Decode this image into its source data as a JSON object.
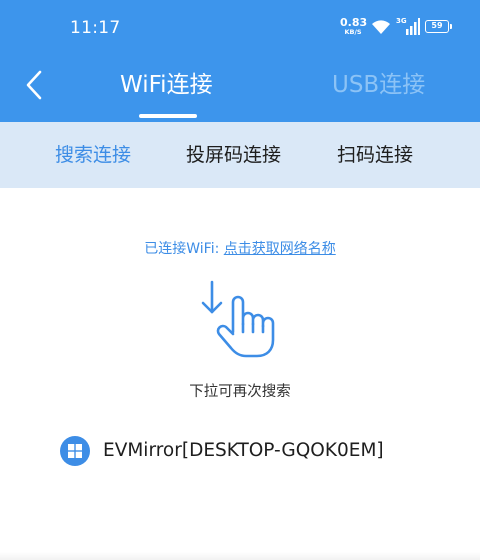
{
  "status_bar": {
    "time": "11:17",
    "net_speed_value": "0.83",
    "net_speed_unit": "KB/S",
    "network_type": "3G",
    "battery": "59"
  },
  "header": {
    "tabs": [
      {
        "label": "WiFi连接",
        "active": true
      },
      {
        "label": "USB连接",
        "active": false
      }
    ]
  },
  "sub_tabs": [
    {
      "label": "搜索连接",
      "active": true
    },
    {
      "label": "投屏码连接",
      "active": false
    },
    {
      "label": "扫码连接",
      "active": false
    }
  ],
  "main": {
    "connected_prefix": "已连接WiFi: ",
    "connected_link": "点击获取网络名称",
    "pull_hint": "下拉可再次搜索",
    "devices": [
      {
        "name": "EVMirror[DESKTOP-GQOK0EM]",
        "icon": "windows-icon"
      }
    ]
  },
  "colors": {
    "primary": "#3d95ec",
    "subtab_bar": "#dae8f7",
    "accent_text": "#3d8de6",
    "inactive_tab": "#8cc3f6"
  }
}
